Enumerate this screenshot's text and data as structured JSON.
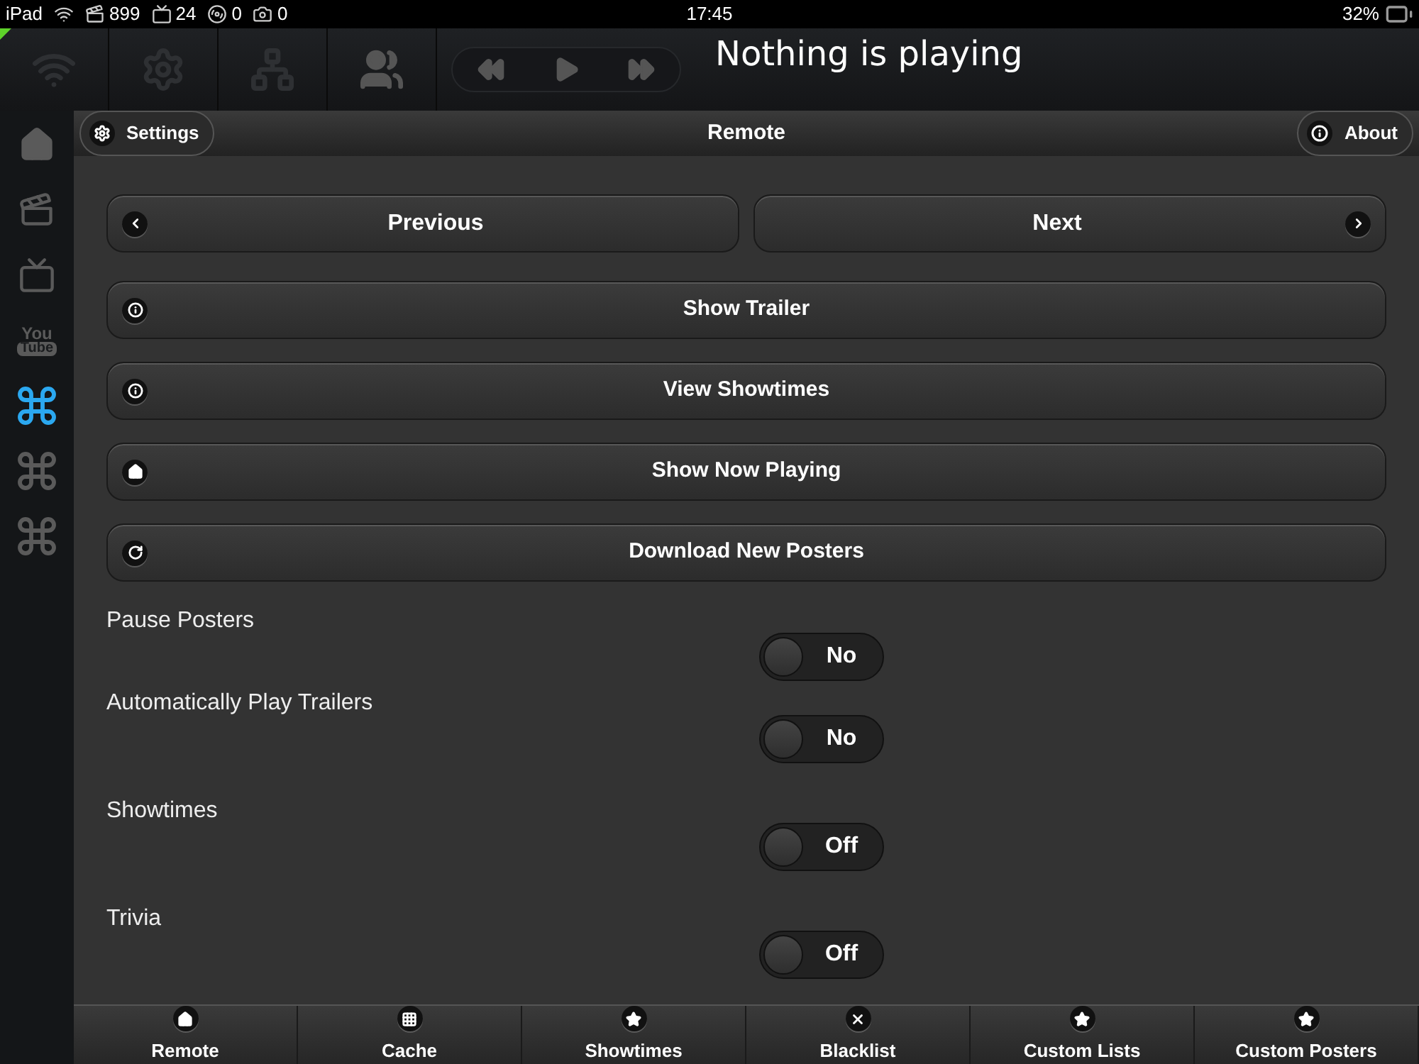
{
  "status_bar": {
    "device": "iPad",
    "counters": [
      {
        "kind": "clapper",
        "value": "899"
      },
      {
        "kind": "tv",
        "value": "24"
      },
      {
        "kind": "disc",
        "value": "0"
      },
      {
        "kind": "camera",
        "value": "0"
      }
    ],
    "time": "17:45",
    "battery": "32%"
  },
  "toolbar": {
    "tools": [
      {
        "kind": "wifi"
      },
      {
        "kind": "gear"
      },
      {
        "kind": "network"
      },
      {
        "kind": "users"
      }
    ],
    "now_playing": "Nothing is playing"
  },
  "sidebar": {
    "items": [
      {
        "kind": "home",
        "selected": false
      },
      {
        "kind": "clapper",
        "selected": false
      },
      {
        "kind": "tv",
        "selected": false
      },
      {
        "kind": "youtube",
        "logo_lines": [
          "You",
          "Tube"
        ],
        "selected": false
      },
      {
        "kind": "command",
        "selected": true
      },
      {
        "kind": "command",
        "selected": false
      },
      {
        "kind": "command",
        "selected": false
      }
    ]
  },
  "header": {
    "left_button": "Settings",
    "title": "Remote",
    "right_button": "About"
  },
  "nav_buttons": [
    {
      "label": "Previous",
      "kind": "back"
    },
    {
      "label": "Next",
      "kind": "forward"
    }
  ],
  "actions": [
    {
      "label": "Show Trailer",
      "kind": "info"
    },
    {
      "label": "View Showtimes",
      "kind": "info"
    },
    {
      "label": "Show Now Playing",
      "kind": "home"
    },
    {
      "label": "Download New Posters",
      "kind": "refresh"
    }
  ],
  "settings": [
    {
      "label": "Pause Posters",
      "value": "No",
      "on": false
    },
    {
      "label": "Automatically Play Trailers",
      "value": "No",
      "on": false
    },
    {
      "label": "Showtimes",
      "value": "Off",
      "on": false
    },
    {
      "label": "Trivia",
      "value": "Off",
      "on": false
    }
  ],
  "tabs": [
    {
      "label": "Remote",
      "kind": "home",
      "selected": false
    },
    {
      "label": "Cache",
      "kind": "grid",
      "selected": false
    },
    {
      "label": "Showtimes",
      "kind": "star",
      "selected": false
    },
    {
      "label": "Blacklist",
      "kind": "close",
      "selected": false
    },
    {
      "label": "Custom Lists",
      "kind": "star",
      "selected": false
    },
    {
      "label": "Custom Posters",
      "kind": "star",
      "selected": false
    }
  ]
}
